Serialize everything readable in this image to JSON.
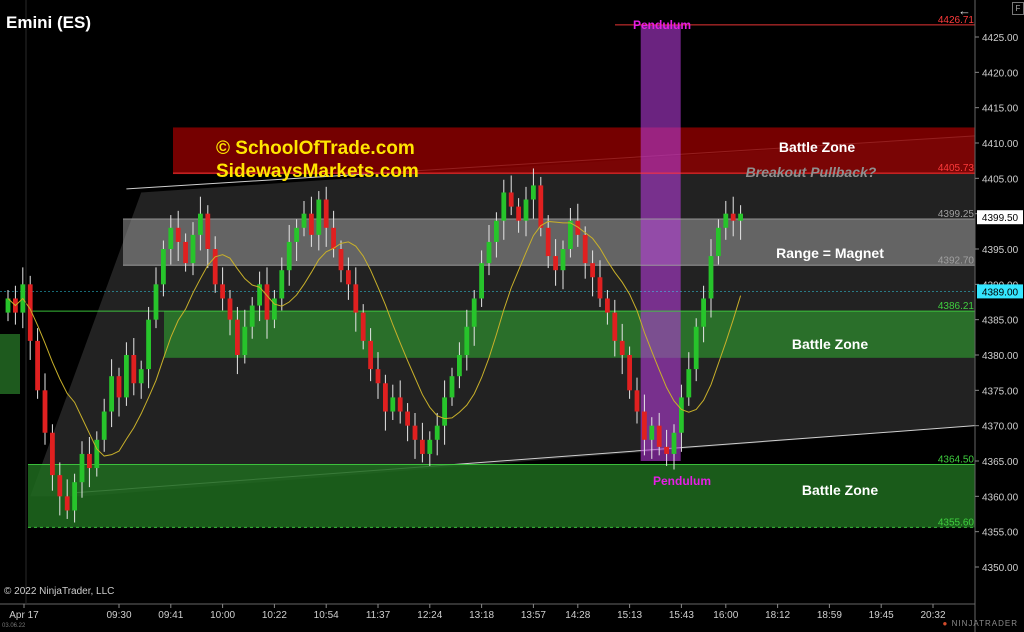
{
  "title": "Emini (ES)",
  "copyright": "© 2022 NinjaTrader, LLC",
  "brand": {
    "prefix": "●",
    "name": "NINJATRADER"
  },
  "corner_icon": "F",
  "back_icon": "←",
  "date_stamp": "03.06.22",
  "chart_data": {
    "type": "candlestick",
    "ylim": [
      4345,
      4430
    ],
    "y_ticks": [
      4350,
      4355,
      4360,
      4365,
      4370,
      4375,
      4380,
      4385,
      4390,
      4395,
      4400,
      4405,
      4410,
      4415,
      4420,
      4425
    ],
    "x_ticks": [
      {
        "label": "Apr 17",
        "bar": 0
      },
      {
        "label": "09:30",
        "bar": 15
      },
      {
        "label": "09:41",
        "bar": 22
      },
      {
        "label": "10:00",
        "bar": 29
      },
      {
        "label": "10:22",
        "bar": 36
      },
      {
        "label": "10:54",
        "bar": 43
      },
      {
        "label": "11:37",
        "bar": 50
      },
      {
        "label": "12:24",
        "bar": 57
      },
      {
        "label": "13:18",
        "bar": 64
      },
      {
        "label": "13:57",
        "bar": 71
      },
      {
        "label": "14:28",
        "bar": 77
      },
      {
        "label": "15:13",
        "bar": 84
      },
      {
        "label": "15:43",
        "bar": 91
      },
      {
        "label": "16:00",
        "bar": 97
      },
      {
        "label": "18:12",
        "bar": 104
      },
      {
        "label": "18:59",
        "bar": 111
      },
      {
        "label": "19:45",
        "bar": 118
      },
      {
        "label": "20:32",
        "bar": 125
      }
    ],
    "closes": [
      4388,
      4386,
      4390,
      4382,
      4375,
      4369,
      4363,
      4360,
      4358,
      4362,
      4366,
      4364,
      4368,
      4372,
      4377,
      4374,
      4380,
      4376,
      4378,
      4385,
      4390,
      4395,
      4398,
      4396,
      4393,
      4397,
      4400,
      4395,
      4390,
      4388,
      4385,
      4380,
      4384,
      4387,
      4390,
      4385,
      4388,
      4392,
      4396,
      4398,
      4400,
      4397,
      4402,
      4398,
      4395,
      4392,
      4390,
      4386,
      4382,
      4378,
      4376,
      4372,
      4374,
      4372,
      4370,
      4368,
      4366,
      4368,
      4370,
      4374,
      4377,
      4380,
      4384,
      4388,
      4393,
      4396,
      4399,
      4403,
      4401,
      4399,
      4402,
      4404,
      4398,
      4394,
      4392,
      4395,
      4399,
      4397,
      4393,
      4391,
      4388,
      4386,
      4382,
      4380,
      4375,
      4372,
      4368,
      4370,
      4367,
      4366,
      4369,
      4374,
      4378,
      4384,
      4388,
      4394,
      4398,
      4400,
      4399,
      4400
    ],
    "ma_label": "20 SMA",
    "levels": [
      {
        "label": "4426.71",
        "value": 4426.71,
        "color": "#ff3b3b"
      },
      {
        "label": "4405.73",
        "value": 4405.73,
        "color": "#ff3b3b"
      },
      {
        "label": "4399.25",
        "value": 4399.25,
        "color": "#a0a0a0"
      },
      {
        "label": "4392.70",
        "value": 4392.7,
        "color": "#a0a0a0"
      },
      {
        "label": "4386.21",
        "value": 4386.21,
        "color": "#3fcf3f"
      },
      {
        "label": "4364.50",
        "value": 4364.5,
        "color": "#3fcf3f"
      },
      {
        "label": "4355.60",
        "value": 4355.6,
        "color": "#3fcf3f"
      }
    ],
    "price_markers": [
      {
        "label": "4399.50",
        "value": 4399.5,
        "bg": "#ffffff",
        "fg": "#000000"
      },
      {
        "label": "4389.00",
        "value": 4389.0,
        "bg": "#35e6ff",
        "fg": "#000000"
      }
    ],
    "zones": [
      {
        "name": "Battle Zone",
        "y_top": 4412.2,
        "y_bot": 4405.6,
        "color": "#8a0000",
        "opacity": 0.85
      },
      {
        "name": "Range = Magnet",
        "y_top": 4399.2,
        "y_bot": 4392.7,
        "color": "#9a9a9a",
        "opacity": 0.55
      },
      {
        "name": "Battle Zone",
        "y_top": 4386.2,
        "y_bot": 4379.6,
        "color": "#2e8a2e",
        "opacity": 0.75
      },
      {
        "name": "Battle Zone",
        "y_top": 4364.5,
        "y_bot": 4355.6,
        "color": "#1f6b1f",
        "opacity": 0.85
      }
    ],
    "annotations": {
      "site1": "© SchoolOfTrade.com",
      "site2": "SidewaysMarkets.com",
      "battle_top": "Battle Zone",
      "breakout": "Breakout Pullback?",
      "range": "Range = Magnet",
      "battle_mid": "Battle Zone",
      "battle_low": "Battle Zone",
      "pendulum_top": "Pendulum",
      "pendulum_bottom": "Pendulum"
    }
  }
}
